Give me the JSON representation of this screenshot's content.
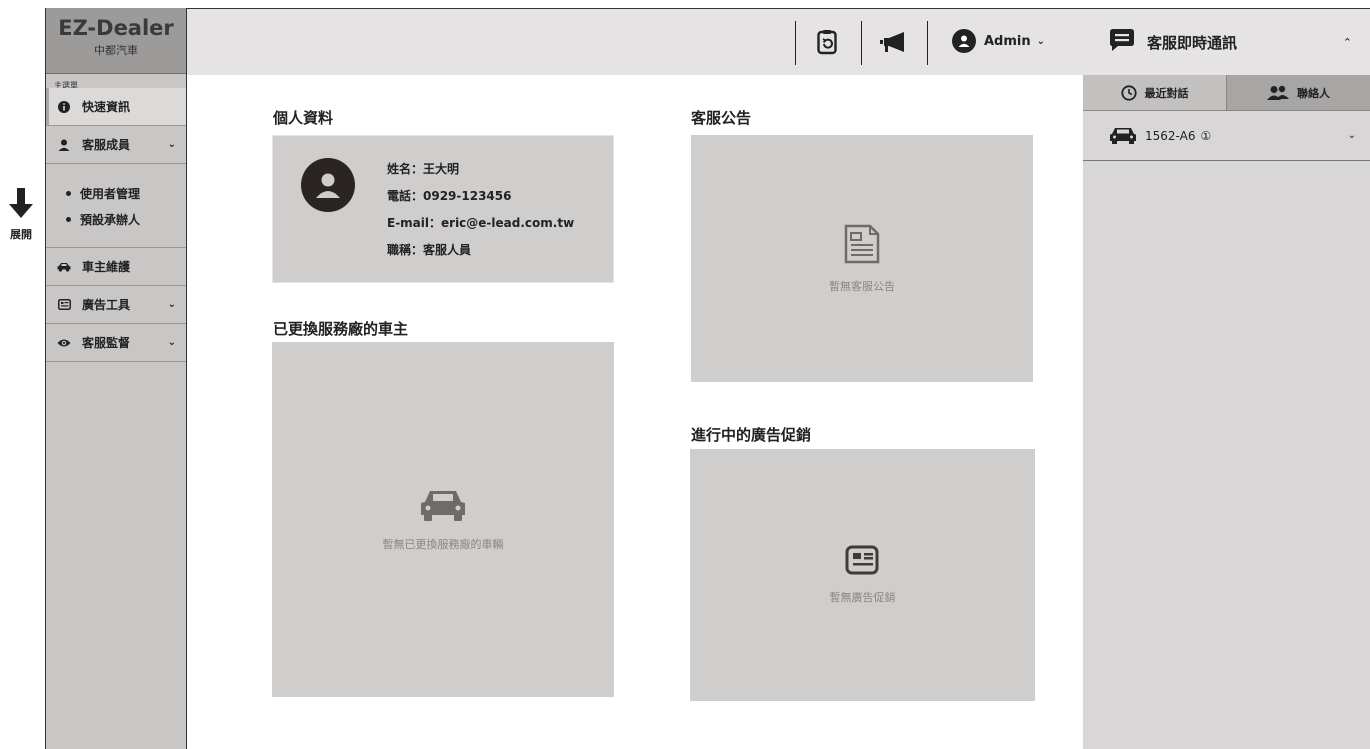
{
  "annotation": {
    "expand_label": "展開"
  },
  "brand": {
    "name": "EZ-Dealer",
    "subtitle": "中都汽車"
  },
  "sidebar": {
    "caption": "主選單",
    "items": [
      {
        "label": "快速資訊",
        "icon": "info-icon"
      },
      {
        "label": "客服成員",
        "icon": "user-icon"
      },
      {
        "label": "車主維護",
        "icon": "car-icon"
      },
      {
        "label": "廣告工具",
        "icon": "ad-icon"
      },
      {
        "label": "客服監督",
        "icon": "eye-icon"
      }
    ],
    "submenu": [
      {
        "label": "使用者管理"
      },
      {
        "label": "預設承辦人"
      }
    ]
  },
  "topbar": {
    "user_label": "Admin"
  },
  "profile": {
    "title": "個人資料",
    "name_line": "姓名：王大明",
    "phone_line": "電話：0929-123456",
    "email_line": "E-mail：eric@e-lead.com.tw",
    "role_line": "職稱：客服人員"
  },
  "announcements": {
    "title": "客服公告",
    "empty_text": "暫無客服公告"
  },
  "changed_owners": {
    "title": "已更換服務廠的車主",
    "empty_text": "暫無已更換服務廠的車輛"
  },
  "promotions": {
    "title": "進行中的廣告促銷",
    "empty_text": "暫無廣告促銷"
  },
  "chat": {
    "title": "客服即時通訊",
    "tabs": [
      {
        "label": "最近對話"
      },
      {
        "label": "聯絡人"
      }
    ],
    "conversations": [
      {
        "plate": "1562-A6",
        "badge": "①"
      }
    ]
  }
}
